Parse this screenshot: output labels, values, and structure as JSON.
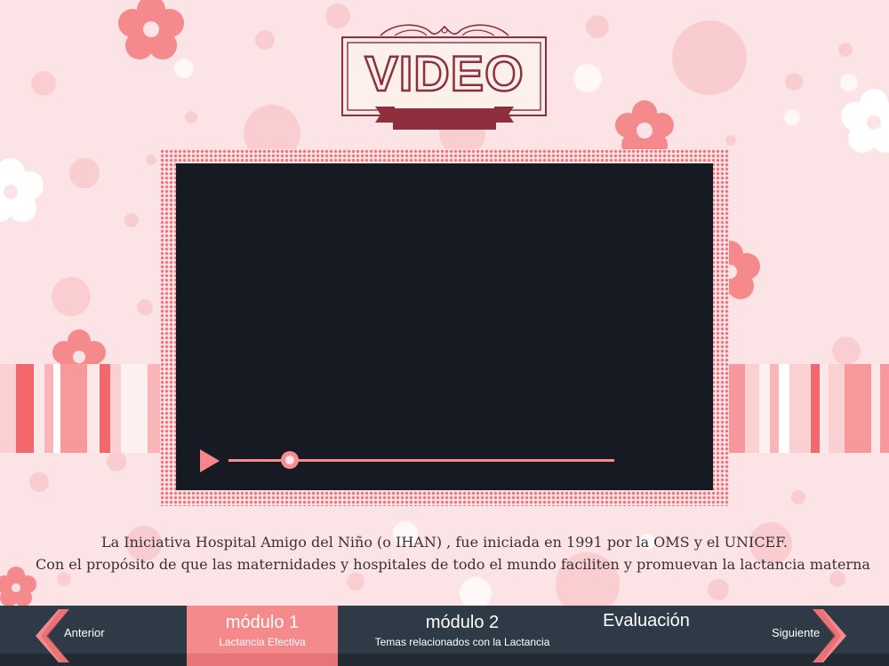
{
  "header": {
    "title": "VIDEO"
  },
  "video": {
    "progress": 0.16
  },
  "caption": {
    "line1": "La Iniciativa Hospital Amigo del Niño (o IHAN) , fue iniciada en 1991 por la OMS y el UNICEF.",
    "line2": "Con el propósito de que las maternidades y hospitales de todo el mundo faciliten y promuevan la lactancia materna"
  },
  "nav": {
    "prev_label": "Anterior",
    "next_label": "Siguiente",
    "tabs": [
      {
        "title": "módulo 1",
        "subtitle": "Lactancia Efectiva"
      },
      {
        "title": "módulo 2",
        "subtitle": "Temas relacionados con la Lactancia"
      },
      {
        "title": "Evaluación",
        "subtitle": ""
      }
    ]
  },
  "colors": {
    "background": "#fce4e6",
    "accent": "#f58a8c",
    "nav_bar": "#2f3a47",
    "badge_ribbon": "#8e2f3e",
    "video_screen": "#161a22"
  }
}
